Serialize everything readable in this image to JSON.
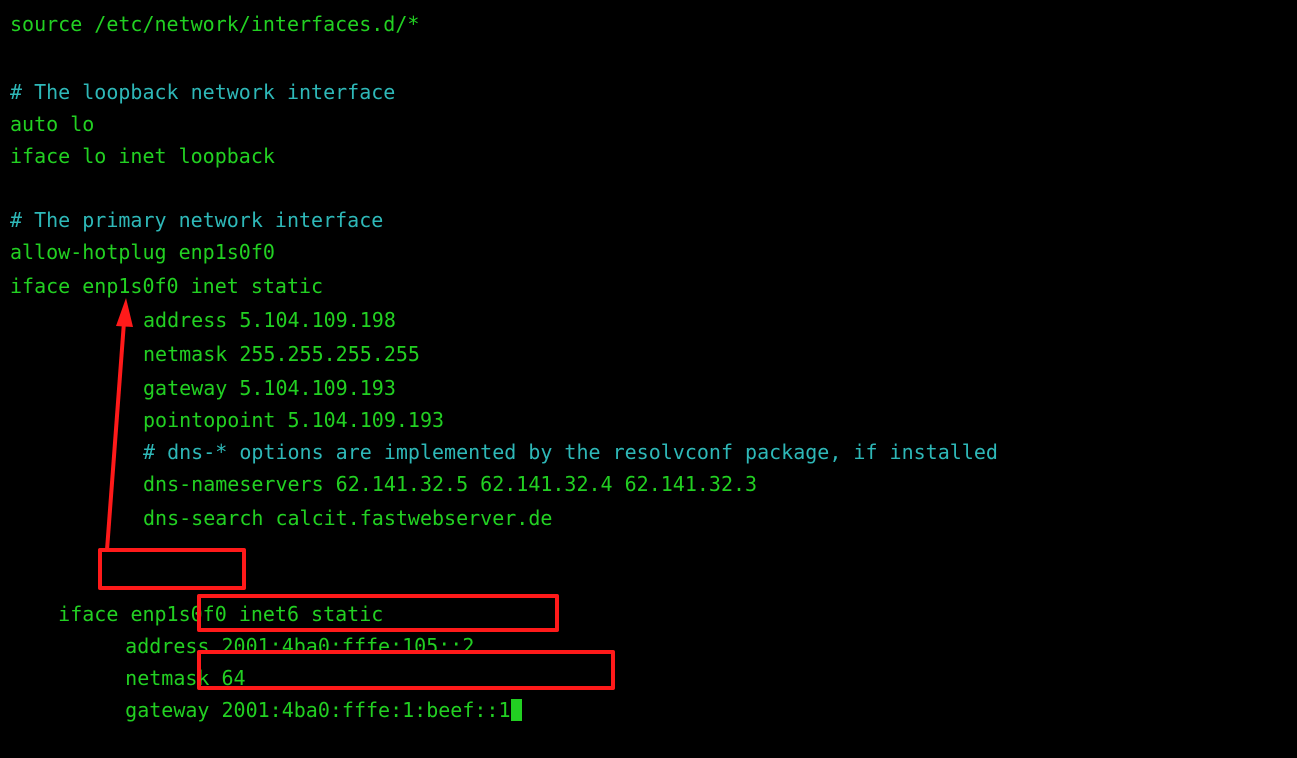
{
  "terminal": {
    "colors": {
      "background": "#000000",
      "code": "#22d022",
      "comment": "#2eb8b8",
      "annotation": "#ff1a1a"
    },
    "lines": {
      "l1": "source /etc/network/interfaces.d/*",
      "l2": "# The loopback network interface",
      "l3": "auto lo",
      "l4": "iface lo inet loopback",
      "l5": "# The primary network interface",
      "l6": "allow-hotplug enp1s0f0",
      "l7": "iface enp1s0f0 inet static",
      "l8": "address 5.104.109.198",
      "l9": "netmask 255.255.255.255",
      "l10": "gateway 5.104.109.193",
      "l11": "pointopoint 5.104.109.193",
      "l12": "# dns-* options are implemented by the resolvconf package, if installed",
      "l13": "dns-nameservers 62.141.32.5 62.141.32.4 62.141.32.3",
      "l14": "dns-search calcit.fastwebserver.de",
      "l15_kw": "iface",
      "l15_if": "enp1s0f0",
      "l15_rest": "inet6 static",
      "l16_kw": "address",
      "l16_val": "2001:4ba0:fffe:105::2",
      "l17_kw": "netmask",
      "l17_val": "64",
      "l18_kw": "gateway",
      "l18_val": "2001:4ba0:fffe:1:beef::1"
    }
  }
}
